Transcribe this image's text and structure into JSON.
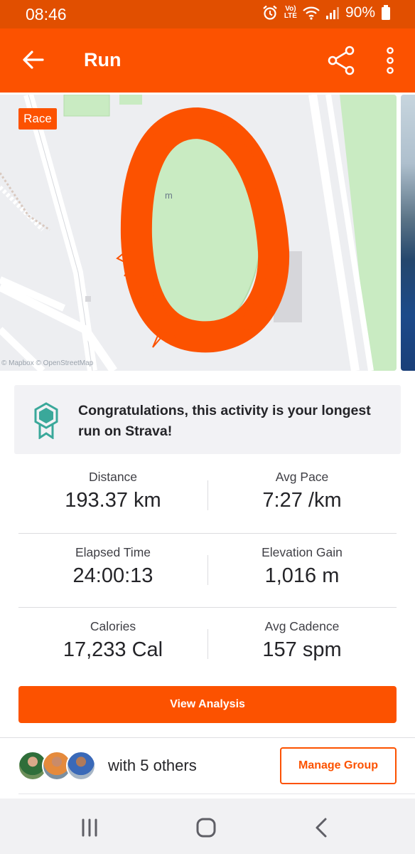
{
  "status_bar": {
    "time": "08:46",
    "battery": "90%",
    "net_label_top": "Vo)",
    "net_label_bottom": "LTE"
  },
  "app_bar": {
    "title": "Run",
    "icons": [
      "back-arrow-icon",
      "share-icon",
      "more-vertical-icon"
    ]
  },
  "map": {
    "badge": "Race",
    "attribution": "© Mapbox © OpenStreetMap",
    "map_label": "m",
    "route_color": "#fc5200"
  },
  "achievement": {
    "message": "Congratulations, this activity is your longest run on Strava!",
    "icon": "medal-icon",
    "icon_color": "#3aa89a"
  },
  "stats": [
    {
      "label": "Distance",
      "value": "193.37 km"
    },
    {
      "label": "Avg Pace",
      "value": "7:27 /km"
    },
    {
      "label": "Elapsed Time",
      "value": "24:00:13"
    },
    {
      "label": "Elevation Gain",
      "value": "1,016 m"
    },
    {
      "label": "Calories",
      "value": "17,233 Cal"
    },
    {
      "label": "Avg Cadence",
      "value": "157 spm"
    }
  ],
  "actions": {
    "view_analysis": "View Analysis",
    "manage_group": "Manage Group"
  },
  "group": {
    "with_text": "with 5 others",
    "avatar_count": 3
  },
  "colors": {
    "brand": "#fc5200",
    "status_bar": "#e14f00"
  }
}
